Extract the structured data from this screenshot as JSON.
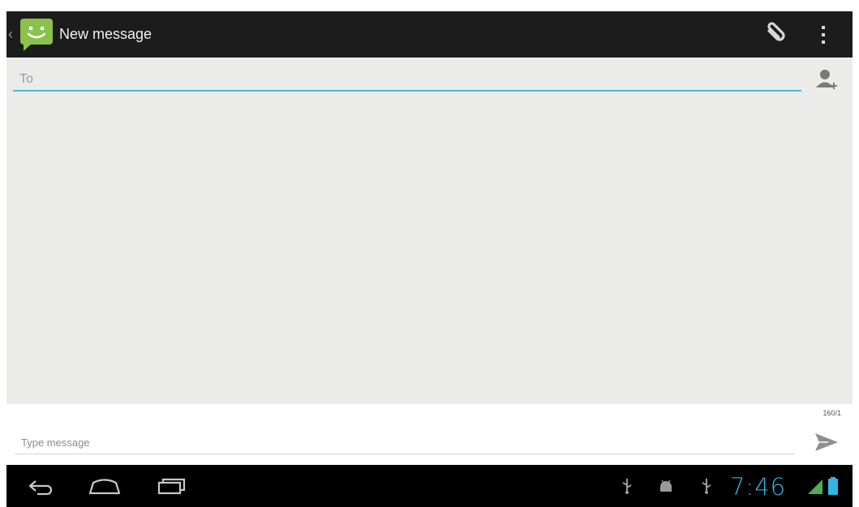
{
  "action_bar": {
    "title": "New message",
    "app_icon": "messaging-app-icon",
    "attach_icon": "paperclip-icon",
    "overflow_icon": "overflow-menu-icon"
  },
  "recipients": {
    "to_placeholder": "To",
    "to_value": "",
    "contact_icon": "add-contact-icon"
  },
  "compose": {
    "char_counter": "160/1",
    "message_placeholder": "Type message",
    "message_value": "",
    "send_icon": "send-icon"
  },
  "system_bar": {
    "clock": "7:46",
    "nav_icons": [
      "back-icon",
      "home-icon",
      "recent-apps-icon"
    ],
    "status_icons": [
      "usb-icon",
      "android-debug-icon",
      "usb-icon",
      "signal-icon",
      "battery-icon"
    ]
  },
  "colors": {
    "action_bar": "#1c1c1c",
    "content_bg": "#ebebe9",
    "accent": "#33b5e5",
    "app_icon_green": "#8bc34a"
  }
}
